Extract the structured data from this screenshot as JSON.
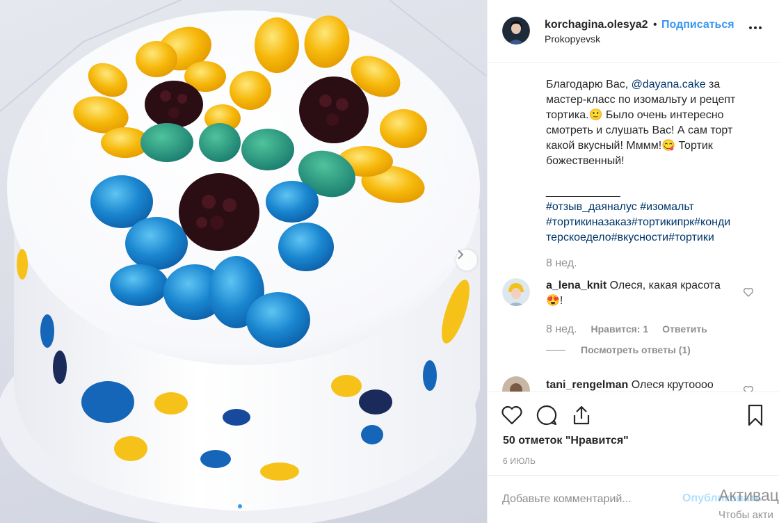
{
  "post": {
    "username": "korchagina.olesya2",
    "bullet": "•",
    "follow_label": "Подписаться",
    "location": "Prokopyevsk",
    "more_icon": "more-horizontal-icon"
  },
  "caption": {
    "lines": [
      {
        "pre": "Благодарю Вас, ",
        "mention": "@dayana.cake",
        "post": " за"
      },
      {
        "text": "мастер-класс по изомальту и рецепт"
      },
      {
        "text": "тортика.🙂 Было очень интересно"
      },
      {
        "text": "смотреть и слушать Вас! А сам торт"
      },
      {
        "text": "какой вкусный! Мммм!😋 Тортик"
      },
      {
        "text": "божественный!"
      }
    ],
    "divider": "____________",
    "hashtag_lines": [
      "#отзыв_даяналус #изомальт",
      "#тортикиназаказ#тортикипрк#конди",
      "терскоедело#вкусности#тортики"
    ],
    "time": "8 нед."
  },
  "comments": [
    {
      "username": "a_lena_knit",
      "text_line1": " Олеся, какая красота",
      "text_line2": "😍!",
      "time": "8 нед.",
      "likes_label": "Нравится: 1",
      "reply_label": "Ответить",
      "view_replies_label": "Посмотреть ответы (1)"
    },
    {
      "username": "tani_rengelman",
      "text_line1": " Олеся крутоооо"
    }
  ],
  "actions": {
    "like_icon": "heart-icon",
    "comment_icon": "comment-icon",
    "share_icon": "share-icon",
    "save_icon": "bookmark-icon",
    "likes_text": "50 отметок \"Нравится\"",
    "date": "6 ИЮЛЬ"
  },
  "add_comment": {
    "placeholder": "Добавьте комментарий...",
    "publish_label": "Опубликовать"
  },
  "watermark": {
    "line1": "Активац",
    "line2": "Чтобы акти"
  },
  "carousel": {
    "next_icon": "chevron-right-icon",
    "slide_count": 2,
    "active_index": 0
  },
  "colors": {
    "link": "#3897f0",
    "mention": "#003569",
    "muted": "#8e8e8e",
    "text": "#262626"
  }
}
